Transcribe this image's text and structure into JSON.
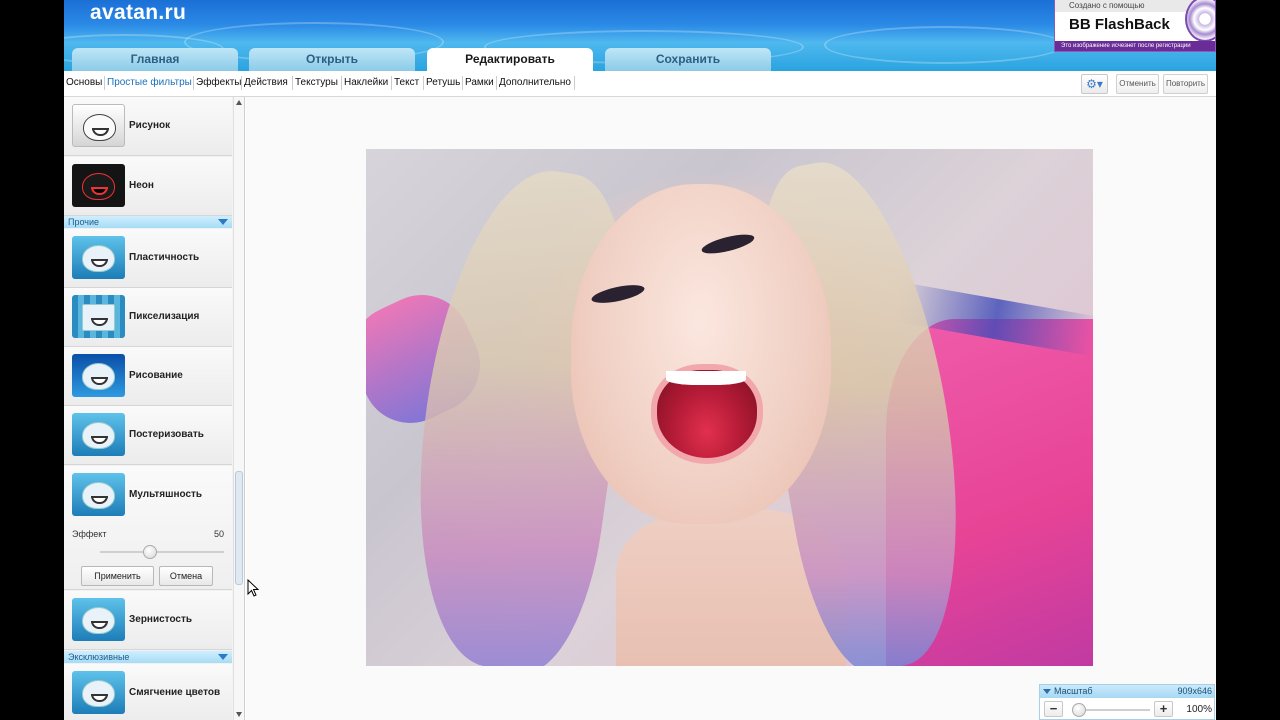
{
  "header": {
    "logo": "avatan.ru",
    "tabs": [
      {
        "label": "Главная"
      },
      {
        "label": "Открыть"
      },
      {
        "label": "Редактировать"
      },
      {
        "label": "Сохранить"
      }
    ],
    "active_tab": "Редактировать"
  },
  "promo": {
    "top": "Создано с помощью",
    "name": "BB FlashBack",
    "bottom": "Это изображение исчезнет после регистрации"
  },
  "subbar": {
    "items": [
      "Основы",
      "Простые фильтры",
      "Эффекты",
      "Действия",
      "Текстуры",
      "Наклейки",
      "Текст",
      "Ретушь",
      "Рамки",
      "Дополнительно"
    ],
    "active": "Простые фильтры",
    "undo": "Отменить",
    "redo": "Повторить"
  },
  "sidebar": {
    "filters_top": [
      "Рисунок",
      "Неон"
    ],
    "section_other": "Прочие",
    "filters_other": [
      "Пластичность",
      "Пикселизация",
      "Рисование",
      "Постеризовать"
    ],
    "expanded": {
      "label": "Мультяшность",
      "effect_label": "Эффект",
      "effect_value": "50",
      "effect_level": 0.5,
      "apply": "Применить",
      "cancel": "Отмена"
    },
    "filters_after": [
      "Зернистость"
    ],
    "section_exclusive": "Эксклюзивные",
    "filters_exclusive": [
      "Смягчение цветов"
    ]
  },
  "zoom": {
    "title": "Масштаб",
    "dims": "909x646",
    "percent": "100%",
    "minus": "−",
    "plus": "+"
  },
  "colors": {
    "header_blue": "#2b8ae6",
    "section_blue": "#a7dcf5",
    "active_sub": "#1b6fb8"
  }
}
